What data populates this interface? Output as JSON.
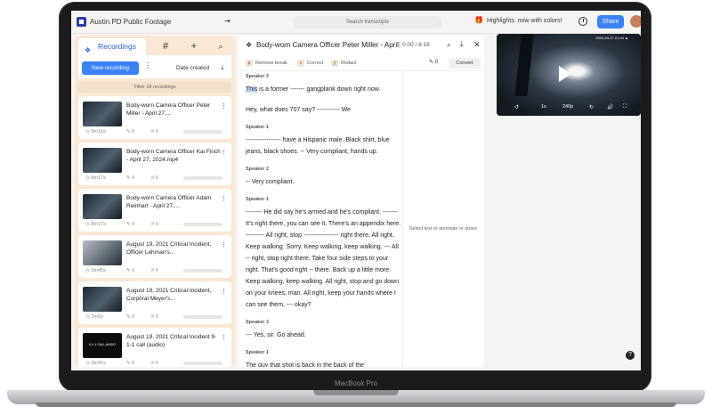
{
  "topbar": {
    "workspace_title": "Austin PD Public Footage",
    "collapse_icon": "⇥",
    "search_placeholder": "Search transcripts",
    "gift_icon": "🎁",
    "highlights_text": "Highlights: now with colors!",
    "share_label": "Share"
  },
  "left_panel": {
    "tabs": {
      "recordings_label": "Recordings",
      "hash_label": "#",
      "add_label": "+",
      "chat_label": "⌕"
    },
    "new_recording_label": "New recording",
    "more_icon": "⋮",
    "sort_label": "Date created",
    "sort_icon": "⇣",
    "filter_text": "Filter 18 recordings",
    "recordings": [
      {
        "title": "Body-worn Camera Officer Peter Miller - April 27,...",
        "duration": "8m16s",
        "highlights": "0",
        "tags": "0",
        "thumb": "",
        "menu": "⋮"
      },
      {
        "title": "Body-worn Camera Officer Kai Finch - April 27, 2024.mp4",
        "duration": "8m17s",
        "highlights": "0",
        "tags": "0",
        "thumb": "",
        "menu": "⋮"
      },
      {
        "title": "Body-worn Camera Officer Adam Reinhart - April 27,...",
        "duration": "8m17s",
        "highlights": "0",
        "tags": "0",
        "thumb": "",
        "menu": "⋮"
      },
      {
        "title": "August 19, 2021 Critical Incident, Officer Lehman's...",
        "duration": "2m45s",
        "highlights": "0",
        "tags": "0",
        "thumb": "",
        "menu": "⋮"
      },
      {
        "title": "August 19, 2021 Critical Incident, Corporal Meyer's...",
        "duration": "2m5s",
        "highlights": "0",
        "tags": "0",
        "thumb": "",
        "menu": "⋮"
      },
      {
        "title": "August 19, 2021 Critical Incident 9-1-1 call (audio)",
        "duration": "3m41s",
        "highlights": "0",
        "tags": "0",
        "thumb": "9-1-1 CALL AUDIO",
        "menu": "⋮"
      }
    ]
  },
  "transcript": {
    "title": "Body-worn Camera Officer Peter Miller - April 27, 2024.mp4",
    "more_icon": "⋮",
    "time": "0:00 / 8:18",
    "tools": {
      "remove_key": "p",
      "remove_label": "Remove break",
      "correct_key": "c",
      "correct_label": "Correct",
      "redact_key": "y",
      "redact_label": "Redact",
      "pen_label": "✎ 0",
      "convert_label": "Convert"
    },
    "annotate_hint": "Select text to annotate or share",
    "blocks": [
      {
        "speaker": "Speaker 3",
        "lines": [
          "This is a former ------- gangplank down right now.",
          "Hey, what does 707 say? ----------- We"
        ]
      },
      {
        "speaker": "Speaker 1",
        "lines": [
          "----------------- have a Hispanic male. Black shirt, blue jeans, black shoes. -- Very compliant, hands up."
        ]
      },
      {
        "speaker": "Speaker 2",
        "lines": [
          "-- Very compliant."
        ]
      },
      {
        "speaker": "Speaker 1",
        "lines": [
          "-------- He did say he's armed and he's compliant. ------- It's right there, you can see it. There's an appendix here. --------- All right, stop ----------------- right there. All right. Keep walking. Sorry. Keep walking, keep walking. --- All -- right, stop right there. Take four side steps to your right. That's good right -- there. Back up a little more. Keep walking, keep walking. All right, stop and go down on your knees, man. All right, keep your hands where I can see them, --- okay?"
        ]
      },
      {
        "speaker": "Speaker 3",
        "lines": [
          "--- Yes, sir. Go ahead."
        ]
      },
      {
        "speaker": "Speaker 1",
        "lines": [
          "The guy that shot is back in the back of the"
        ]
      }
    ]
  },
  "video": {
    "overlay_text": "2024-04-27 21:04 ▲",
    "back_label": "↺",
    "speed_label": "1x",
    "quality_label": "240p",
    "forward_label": "↻",
    "volume_label": "🔊",
    "fullscreen_label": "⛶"
  },
  "help_label": "?",
  "device_label": "MacBook Pro",
  "colors": {
    "accent": "#3b82f6",
    "panel": "#f8e8d5",
    "highlight": "#c7d8fb"
  }
}
